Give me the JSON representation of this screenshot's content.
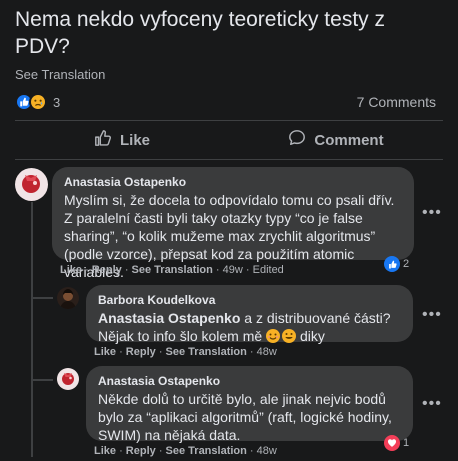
{
  "post": {
    "text": "Nema nekdo vyfoceny teoreticky testy z PDV?",
    "see_translation": "See Translation",
    "reaction_count": "3",
    "comments_label": "7 Comments"
  },
  "actions": {
    "like": "Like",
    "comment": "Comment"
  },
  "comments": [
    {
      "author": "Anastasia Ostapenko",
      "text": "Myslím si, že docela to odpovídalo tomu co psali dřív. Z paralelní časti byli taky otazky typy “co je false sharing”, “o kolik mužeme max zrychlit algoritmus” (podle vzorce), přepsat kod za použitím atomic variables.",
      "like": "Like",
      "reply": "Reply",
      "see_translation": "See Translation",
      "time": "49w",
      "edited": "Edited",
      "reaction_count": "2"
    },
    {
      "author": "Barbora Koudelkova",
      "mention": "Anastasia Ostapenko",
      "text_after_mention": " a z distribuované části? Nějak to info šlo kolem mě",
      "text_after_emoji": " diky",
      "like": "Like",
      "reply": "Reply",
      "see_translation": "See Translation",
      "time": "48w"
    },
    {
      "author": "Anastasia Ostapenko",
      "text": "Někde dolů to určitě bylo, ale jinak nejvic bodů bylo za “aplikaci algoritmů” (raft, logické hodiny, SWIM) na nějaká data.",
      "like": "Like",
      "reply": "Reply",
      "see_translation": "See Translation",
      "time": "48w",
      "reaction_count": "1"
    }
  ],
  "colors": {
    "background": "#18191a",
    "bubble": "#3a3b3c",
    "like_blue": "#1877f2",
    "sad_yellow": "#f7b125",
    "love_red": "#f33e58"
  },
  "icons": [
    "like-icon",
    "sad-icon",
    "thumbs-up-icon",
    "comment-icon",
    "more-icon",
    "love-icon",
    "smile-icon"
  ]
}
